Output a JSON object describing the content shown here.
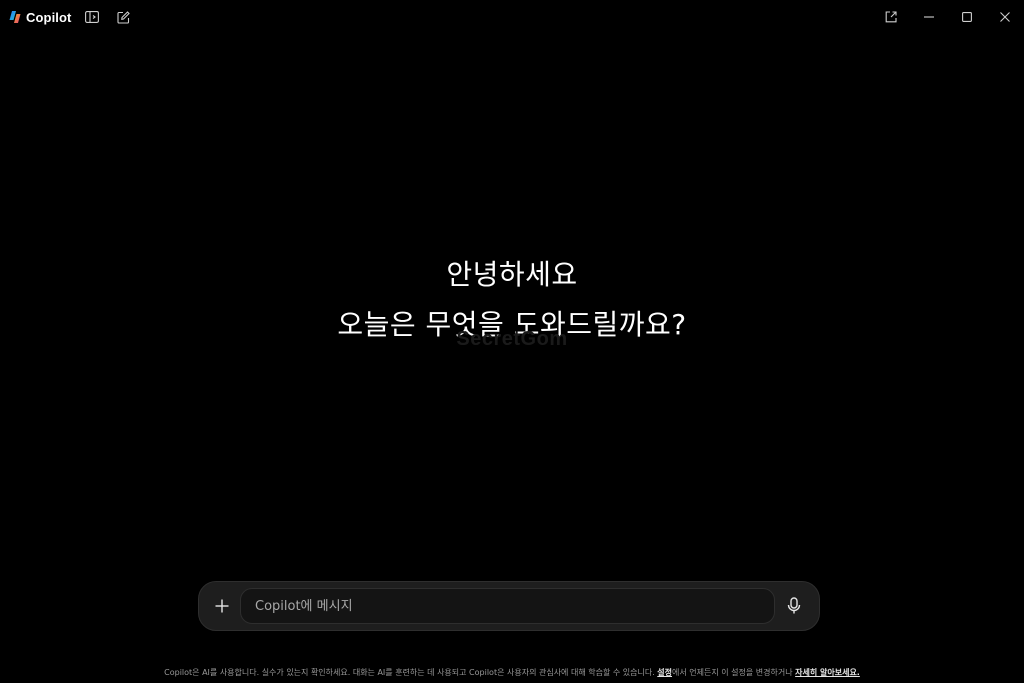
{
  "app": {
    "name": "Copilot"
  },
  "greeting": {
    "line1": "안녕하세요",
    "line2": "오늘은 무엇을 도와드릴까요?"
  },
  "watermark": "SecretGom",
  "composer": {
    "placeholder": "Copilot에 메시지"
  },
  "footer": {
    "text_before": "Copilot은 AI를 사용합니다. 실수가 있는지 확인하세요. 대화는 AI를 훈련하는 데 사용되고 Copilot은 사용자의 관심사에 대해 학습할 수 있습니다. ",
    "settings_link": "설정",
    "text_middle": "에서 언제든지 이 설정을 변경하거나 ",
    "learn_more_link": "자세히 알아보세요."
  },
  "icons": {
    "logo": "copilot-logo",
    "sidebar": "sidebar-toggle-icon",
    "new_chat": "compose-icon",
    "popout": "popout-icon",
    "minimize": "minimize-icon",
    "maximize": "maximize-icon",
    "close": "close-icon",
    "attach": "plus-icon",
    "mic": "microphone-icon"
  },
  "colors": {
    "background": "#000000",
    "composer_bg": "#1e1e1e",
    "input_bg": "#141414",
    "text": "#ffffff",
    "muted_text": "#9a9a9a"
  }
}
